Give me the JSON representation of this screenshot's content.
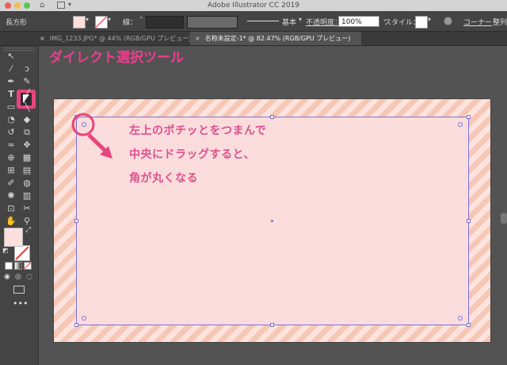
{
  "window": {
    "title": "Adobe Illustrator CC 2019"
  },
  "controlbar": {
    "object_type": "長方形",
    "stroke_label": "線：",
    "stroke_profile": "基本",
    "opacity_label": "不透明度：",
    "opacity_value": "100%",
    "style_label": "スタイル：",
    "corner_label": "コーナー",
    "align_label": "整列",
    "fill_color": "#fcdedc"
  },
  "tabs": [
    {
      "label": "IMG_1233.JPG* @ 44% (RGB/GPU プレビュー)",
      "active": false
    },
    {
      "label": "名称未設定-1* @ 82.47% (RGB/GPU プレビュー)",
      "active": true
    }
  ],
  "toolbar": {
    "selected_tool": "direct-selection-tool",
    "fill_color": "#fcdedc"
  },
  "callout": {
    "text": "ダイレクト選択ツール"
  },
  "annotation": {
    "line1": "左上のポチッとをつまんで",
    "line2": "中央にドラッグすると、",
    "line3": "角が丸くなる"
  },
  "colors": {
    "accent": "#e04f8e",
    "stripe_a": "#f6c7b4",
    "stripe_b": "#fde3de",
    "rect_fill": "#fadcdc",
    "selection": "#7d73d9"
  }
}
